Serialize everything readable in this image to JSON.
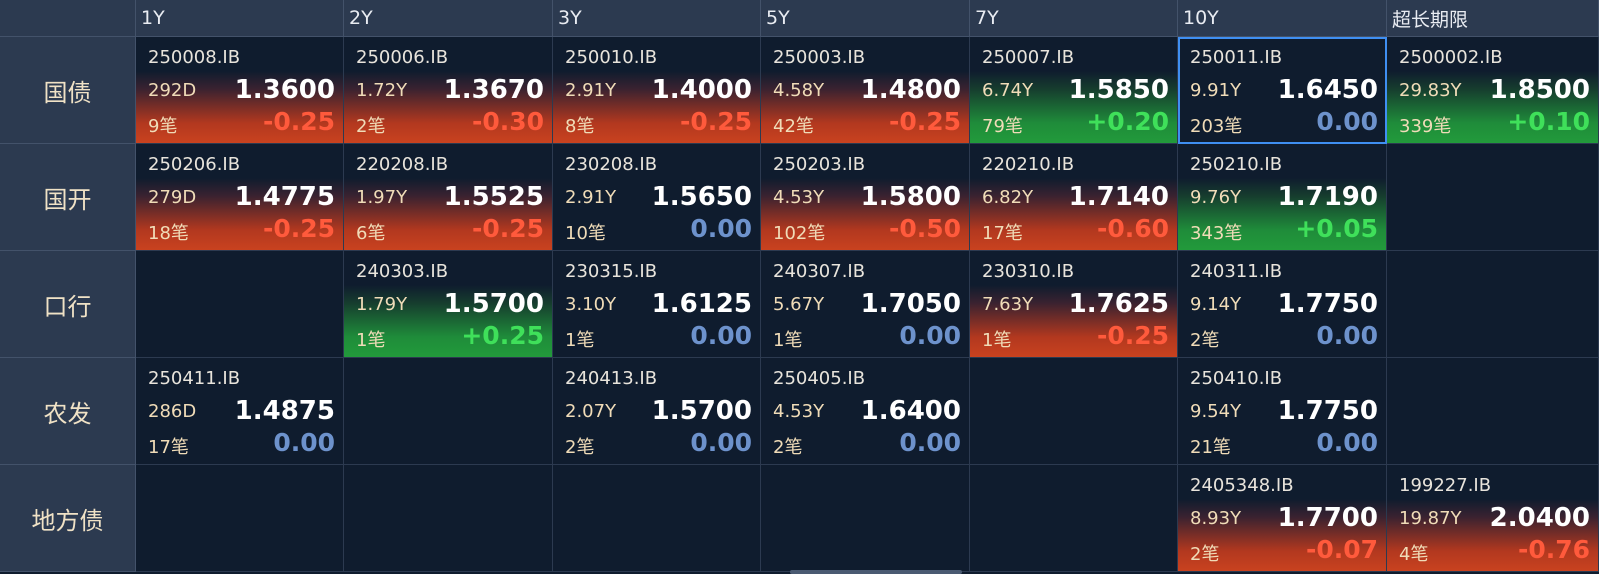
{
  "columns": [
    "1Y",
    "2Y",
    "3Y",
    "5Y",
    "7Y",
    "10Y",
    "超长期限"
  ],
  "rows": [
    {
      "label": "国债",
      "cells": [
        {
          "code": "250008.IB",
          "term": "292D",
          "yield": "1.3600",
          "count": "9笔",
          "change": "-0.25",
          "dir": "down"
        },
        {
          "code": "250006.IB",
          "term": "1.72Y",
          "yield": "1.3670",
          "count": "2笔",
          "change": "-0.30",
          "dir": "down"
        },
        {
          "code": "250010.IB",
          "term": "2.91Y",
          "yield": "1.4000",
          "count": "8笔",
          "change": "-0.25",
          "dir": "down"
        },
        {
          "code": "250003.IB",
          "term": "4.58Y",
          "yield": "1.4800",
          "count": "42笔",
          "change": "-0.25",
          "dir": "down"
        },
        {
          "code": "250007.IB",
          "term": "6.74Y",
          "yield": "1.5850",
          "count": "79笔",
          "change": "+0.20",
          "dir": "up"
        },
        {
          "code": "250011.IB",
          "term": "9.91Y",
          "yield": "1.6450",
          "count": "203笔",
          "change": "0.00",
          "dir": "flat",
          "selected": true
        },
        {
          "code": "2500002.IB",
          "term": "29.83Y",
          "yield": "1.8500",
          "count": "339笔",
          "change": "+0.10",
          "dir": "up"
        }
      ]
    },
    {
      "label": "国开",
      "cells": [
        {
          "code": "250206.IB",
          "term": "279D",
          "yield": "1.4775",
          "count": "18笔",
          "change": "-0.25",
          "dir": "down"
        },
        {
          "code": "220208.IB",
          "term": "1.97Y",
          "yield": "1.5525",
          "count": "6笔",
          "change": "-0.25",
          "dir": "down"
        },
        {
          "code": "230208.IB",
          "term": "2.91Y",
          "yield": "1.5650",
          "count": "10笔",
          "change": "0.00",
          "dir": "flat"
        },
        {
          "code": "250203.IB",
          "term": "4.53Y",
          "yield": "1.5800",
          "count": "102笔",
          "change": "-0.50",
          "dir": "down"
        },
        {
          "code": "220210.IB",
          "term": "6.82Y",
          "yield": "1.7140",
          "count": "17笔",
          "change": "-0.60",
          "dir": "down"
        },
        {
          "code": "250210.IB",
          "term": "9.76Y",
          "yield": "1.7190",
          "count": "343笔",
          "change": "+0.05",
          "dir": "up"
        },
        null
      ]
    },
    {
      "label": "口行",
      "cells": [
        null,
        {
          "code": "240303.IB",
          "term": "1.79Y",
          "yield": "1.5700",
          "count": "1笔",
          "change": "+0.25",
          "dir": "up"
        },
        {
          "code": "230315.IB",
          "term": "3.10Y",
          "yield": "1.6125",
          "count": "1笔",
          "change": "0.00",
          "dir": "flat"
        },
        {
          "code": "240307.IB",
          "term": "5.67Y",
          "yield": "1.7050",
          "count": "1笔",
          "change": "0.00",
          "dir": "flat"
        },
        {
          "code": "230310.IB",
          "term": "7.63Y",
          "yield": "1.7625",
          "count": "1笔",
          "change": "-0.25",
          "dir": "down"
        },
        {
          "code": "240311.IB",
          "term": "9.14Y",
          "yield": "1.7750",
          "count": "2笔",
          "change": "0.00",
          "dir": "flat"
        },
        null
      ]
    },
    {
      "label": "农发",
      "cells": [
        {
          "code": "250411.IB",
          "term": "286D",
          "yield": "1.4875",
          "count": "17笔",
          "change": "0.00",
          "dir": "flat"
        },
        null,
        {
          "code": "240413.IB",
          "term": "2.07Y",
          "yield": "1.5700",
          "count": "2笔",
          "change": "0.00",
          "dir": "flat"
        },
        {
          "code": "250405.IB",
          "term": "4.53Y",
          "yield": "1.6400",
          "count": "2笔",
          "change": "0.00",
          "dir": "flat"
        },
        null,
        {
          "code": "250410.IB",
          "term": "9.54Y",
          "yield": "1.7750",
          "count": "21笔",
          "change": "0.00",
          "dir": "flat"
        },
        null
      ]
    },
    {
      "label": "地方债",
      "cells": [
        null,
        null,
        null,
        null,
        null,
        {
          "code": "2405348.IB",
          "term": "8.93Y",
          "yield": "1.7700",
          "count": "2笔",
          "change": "-0.07",
          "dir": "down"
        },
        {
          "code": "199227.IB",
          "term": "19.87Y",
          "yield": "2.0400",
          "count": "4笔",
          "change": "-0.76",
          "dir": "down"
        }
      ]
    }
  ],
  "colors": {
    "down": "#c9421f",
    "up": "#229a3b",
    "flat": "#6d92cc",
    "selected": "#3f8ff2"
  }
}
